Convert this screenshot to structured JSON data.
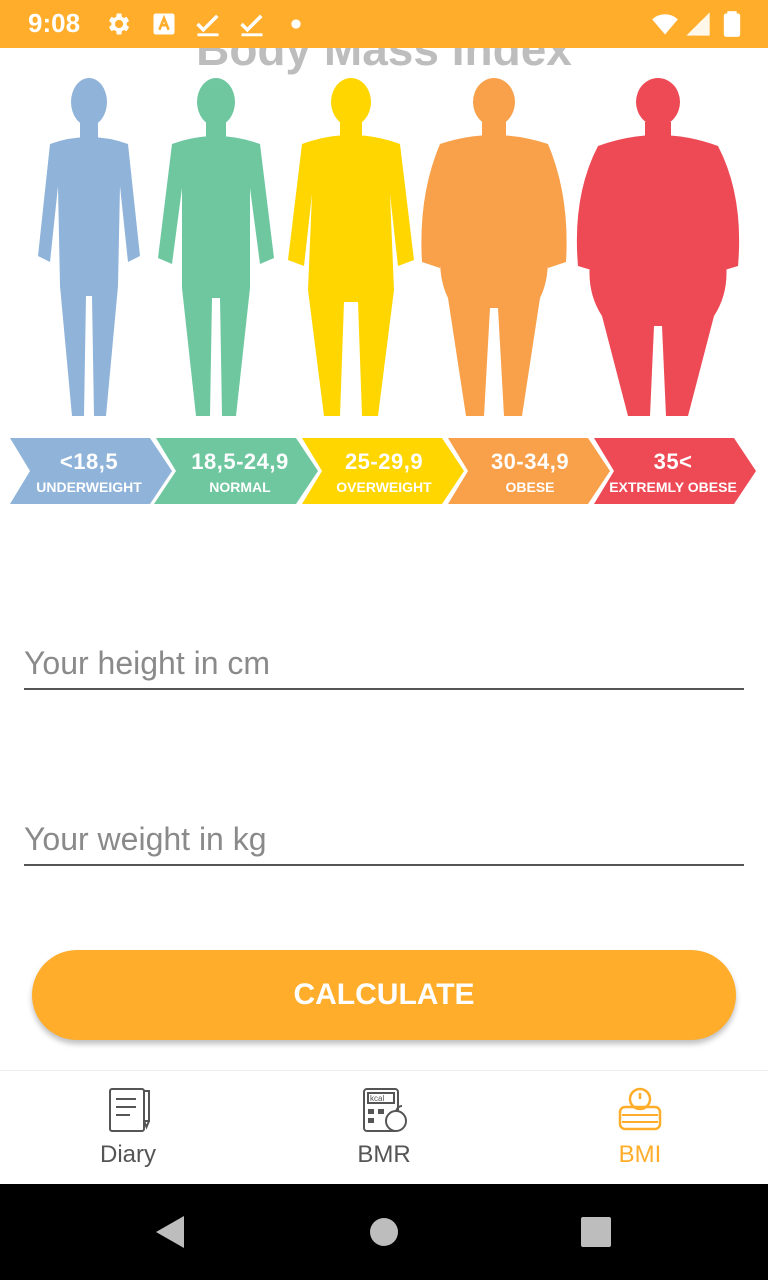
{
  "status_bar": {
    "time": "9:08",
    "icons": [
      "gear-icon",
      "text-a-icon",
      "check-icon",
      "check-icon",
      "dot-icon",
      "wifi-icon",
      "signal-icon",
      "battery-icon"
    ],
    "color": "#FFAD2A"
  },
  "banner": {
    "title": "Body Mass Index",
    "figure_colors": [
      "#8FB3D9",
      "#6FC7A0",
      "#FFD600",
      "#F9A04B",
      "#EE4A55"
    ],
    "segments": [
      {
        "range": "<18,5",
        "name": "UNDERWEIGHT",
        "color": "#8FB3D9"
      },
      {
        "range": "18,5-24,9",
        "name": "NORMAL",
        "color": "#6FC7A0"
      },
      {
        "range": "25-29,9",
        "name": "OVERWEIGHT",
        "color": "#FFD600"
      },
      {
        "range": "30-34,9",
        "name": "OBESE",
        "color": "#F9A04B"
      },
      {
        "range": "35<",
        "name": "EXTREMLY OBESE",
        "color": "#EE4A55"
      }
    ]
  },
  "form": {
    "height_placeholder": "Your height in cm",
    "height_value": "",
    "weight_placeholder": "Your weight in kg",
    "weight_value": "",
    "calculate_label": "CALCULATE"
  },
  "bottom_nav": {
    "items": [
      {
        "label": "Diary",
        "icon": "notebook-icon",
        "active": false
      },
      {
        "label": "BMR",
        "icon": "calculator-apple-icon",
        "active": false
      },
      {
        "label": "BMI",
        "icon": "scale-icon",
        "active": true
      }
    ],
    "accent": "#FFAD2A"
  },
  "system_nav": {
    "icons": [
      "back-icon",
      "home-icon",
      "recents-icon"
    ]
  }
}
